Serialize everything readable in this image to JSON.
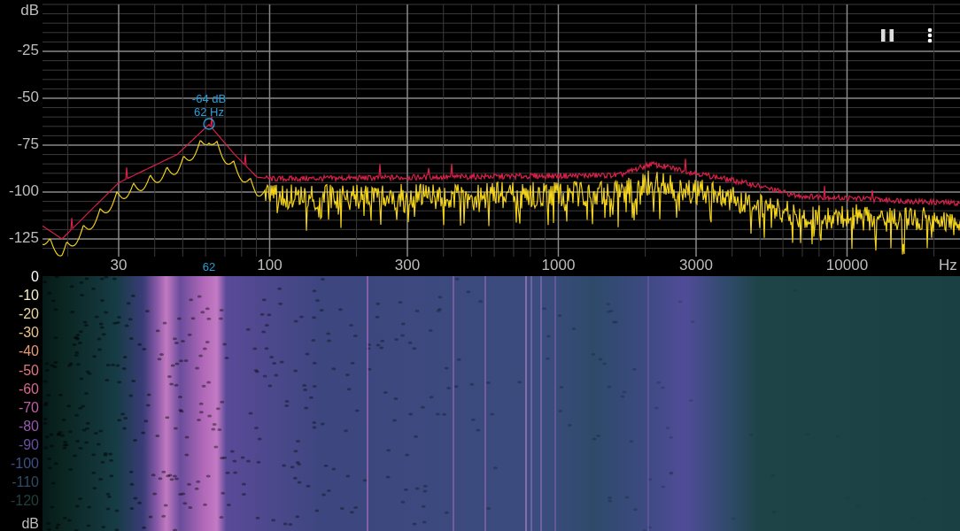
{
  "spectrum": {
    "y_axis": {
      "unit": "dB",
      "ticks": [
        "-25",
        "-50",
        "-75",
        "-100",
        "-125"
      ]
    },
    "x_axis": {
      "ticks": [
        "30",
        "100",
        "300",
        "1000",
        "3000",
        "10000"
      ],
      "unit": "Hz"
    },
    "peak": {
      "level_label": "-64 dB",
      "freq_label": "62 Hz",
      "axis_label": "62"
    }
  },
  "spectrogram": {
    "scale": [
      {
        "label": "0",
        "color": "#ffffff"
      },
      {
        "label": "-10",
        "color": "#f4f0c8"
      },
      {
        "label": "-20",
        "color": "#e8d8a0"
      },
      {
        "label": "-30",
        "color": "#e8c088"
      },
      {
        "label": "-40",
        "color": "#e89a78"
      },
      {
        "label": "-50",
        "color": "#e07880"
      },
      {
        "label": "-60",
        "color": "#d86890"
      },
      {
        "label": "-70",
        "color": "#c060a8"
      },
      {
        "label": "-80",
        "color": "#9858b0"
      },
      {
        "label": "-90",
        "color": "#6850a0"
      },
      {
        "label": "-100",
        "color": "#3c5088"
      },
      {
        "label": "-110",
        "color": "#2c4c68"
      },
      {
        "label": "-120",
        "color": "#20403c"
      }
    ],
    "unit": "dB"
  }
}
